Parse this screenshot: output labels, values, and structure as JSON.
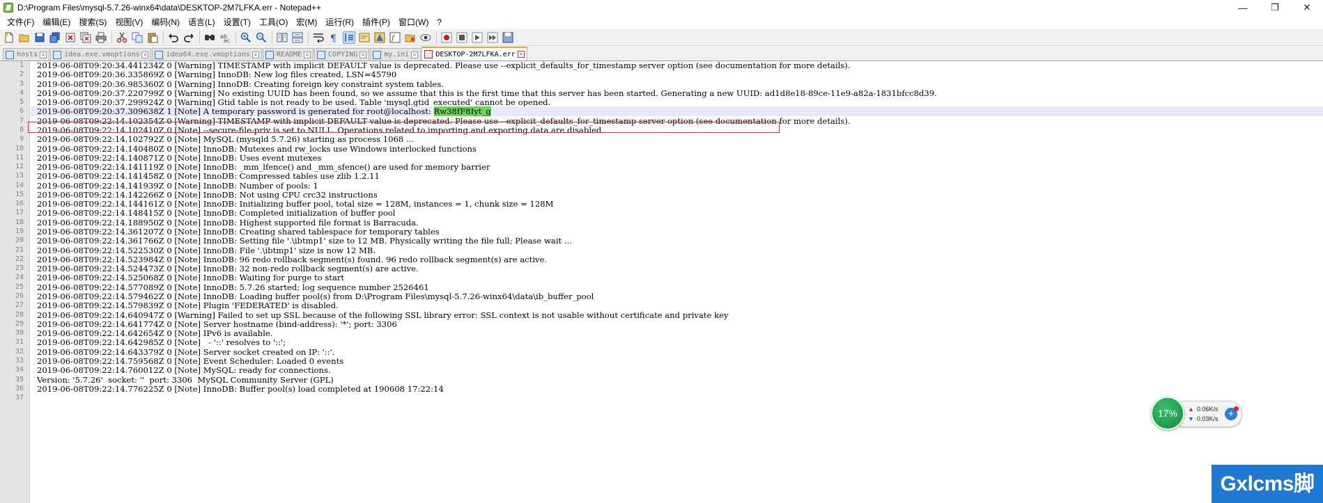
{
  "window": {
    "title": "D:\\Program Files\\mysql-5.7.26-winx64\\data\\DESKTOP-2M7LFKA.err - Notepad++",
    "minimize": "—",
    "restore": "❐",
    "close": "✕"
  },
  "menu": [
    "文件(F)",
    "编辑(E)",
    "搜索(S)",
    "视图(V)",
    "编码(N)",
    "语言(L)",
    "设置(T)",
    "工具(O)",
    "宏(M)",
    "运行(R)",
    "插件(P)",
    "窗口(W)",
    "?"
  ],
  "tabs": [
    {
      "label": "hosts",
      "active": false,
      "unsaved": false
    },
    {
      "label": "idea.exe.vmoptions",
      "active": false,
      "unsaved": false
    },
    {
      "label": "idea64.exe.vmoptions",
      "active": false,
      "unsaved": false
    },
    {
      "label": "README",
      "active": false,
      "unsaved": false
    },
    {
      "label": "COPYING",
      "active": false,
      "unsaved": false
    },
    {
      "label": "my.ini",
      "active": false,
      "unsaved": false
    },
    {
      "label": "DESKTOP-2M7LFKA.err",
      "active": true,
      "unsaved": true
    }
  ],
  "editor": {
    "current_line": 6,
    "highlighted_password": "Rw38fF8Iyt_g",
    "lines": [
      "2019-06-08T09:20:34.441234Z 0 [Warning] TIMESTAMP with implicit DEFAULT value is deprecated. Please use --explicit_defaults_for_timestamp server option (see documentation for more details).",
      "2019-06-08T09:20:36.335869Z 0 [Warning] InnoDB: New log files created, LSN=45790",
      "2019-06-08T09:20:36.985360Z 0 [Warning] InnoDB: Creating foreign key constraint system tables.",
      "2019-06-08T09:20:37.220799Z 0 [Warning] No existing UUID has been found, so we assume that this is the first time that this server has been started. Generating a new UUID: ad1d8e18-89ce-11e9-a82a-1831bfcc8d39.",
      "2019-06-08T09:20:37.299924Z 0 [Warning] Gtid table is not ready to be used. Table 'mysql.gtid_executed' cannot be opened.",
      "2019-06-08T09:20:37.309638Z 1 [Note] A temporary password is generated for root@localhost: ",
      "2019-06-08T09:22:14.102354Z 0 [Warning] TIMESTAMP with implicit DEFAULT value is deprecated. Please use --explicit_defaults_for_timestamp server option (see documentation for more details).",
      "2019-06-08T09:22:14.102410Z 0 [Note] --secure-file-priv is set to NULL. Operations related to importing and exporting data are disabled",
      "2019-06-08T09:22:14.102792Z 0 [Note] MySQL (mysqld 5.7.26) starting as process 1068 ...",
      "2019-06-08T09:22:14.140480Z 0 [Note] InnoDB: Mutexes and rw_locks use Windows interlocked functions",
      "2019-06-08T09:22:14.140871Z 0 [Note] InnoDB: Uses event mutexes",
      "2019-06-08T09:22:14.141119Z 0 [Note] InnoDB: _mm_lfence() and _mm_sfence() are used for memory barrier",
      "2019-06-08T09:22:14.141458Z 0 [Note] InnoDB: Compressed tables use zlib 1.2.11",
      "2019-06-08T09:22:14.141939Z 0 [Note] InnoDB: Number of pools: 1",
      "2019-06-08T09:22:14.142266Z 0 [Note] InnoDB: Not using CPU crc32 instructions",
      "2019-06-08T09:22:14.144161Z 0 [Note] InnoDB: Initializing buffer pool, total size = 128M, instances = 1, chunk size = 128M",
      "2019-06-08T09:22:14.148415Z 0 [Note] InnoDB: Completed initialization of buffer pool",
      "2019-06-08T09:22:14.188950Z 0 [Note] InnoDB: Highest supported file format is Barracuda.",
      "2019-06-08T09:22:14.361207Z 0 [Note] InnoDB: Creating shared tablespace for temporary tables",
      "2019-06-08T09:22:14.361766Z 0 [Note] InnoDB: Setting file '.\\ibtmp1' size to 12 MB. Physically writing the file full; Please wait ...",
      "2019-06-08T09:22:14.522530Z 0 [Note] InnoDB: File '.\\ibtmp1' size is now 12 MB.",
      "2019-06-08T09:22:14.523984Z 0 [Note] InnoDB: 96 redo rollback segment(s) found. 96 redo rollback segment(s) are active.",
      "2019-06-08T09:22:14.524473Z 0 [Note] InnoDB: 32 non-redo rollback segment(s) are active.",
      "2019-06-08T09:22:14.525068Z 0 [Note] InnoDB: Waiting for purge to start",
      "2019-06-08T09:22:14.577089Z 0 [Note] InnoDB: 5.7.26 started; log sequence number 2526461",
      "2019-06-08T09:22:14.579462Z 0 [Note] InnoDB: Loading buffer pool(s) from D:\\Program Files\\mysql-5.7.26-winx64\\data\\ib_buffer_pool",
      "2019-06-08T09:22:14.579839Z 0 [Note] Plugin 'FEDERATED' is disabled.",
      "2019-06-08T09:22:14.640947Z 0 [Warning] Failed to set up SSL because of the following SSL library error: SSL context is not usable without certificate and private key",
      "2019-06-08T09:22:14.641774Z 0 [Note] Server hostname (bind-address): '*'; port: 3306",
      "2019-06-08T09:22:14.642654Z 0 [Note] IPv6 is available.",
      "2019-06-08T09:22:14.642985Z 0 [Note]   - '::' resolves to '::';",
      "2019-06-08T09:22:14.643379Z 0 [Note] Server socket created on IP: '::'.",
      "2019-06-08T09:22:14.759568Z 0 [Note] Event Scheduler: Loaded 0 events",
      "2019-06-08T09:22:14.760012Z 0 [Note] MySQL: ready for connections.",
      "Version: '5.7.26'  socket: ''  port: 3306  MySQL Community Server (GPL)",
      "2019-06-08T09:22:14.776225Z 0 [Note] InnoDB: Buffer pool(s) load completed at 190608 17:22:14",
      ""
    ]
  },
  "net_monitor": {
    "percent": "17%",
    "upload": "0.06K/s",
    "download": "0.03K/s"
  },
  "watermark": "Gxlcms脚本",
  "colors": {
    "active_tab_accent": "#fa9e1e",
    "current_line_bg": "#e8e8ff",
    "password_highlight": "#6cd858",
    "annotation_box": "#e03030"
  }
}
